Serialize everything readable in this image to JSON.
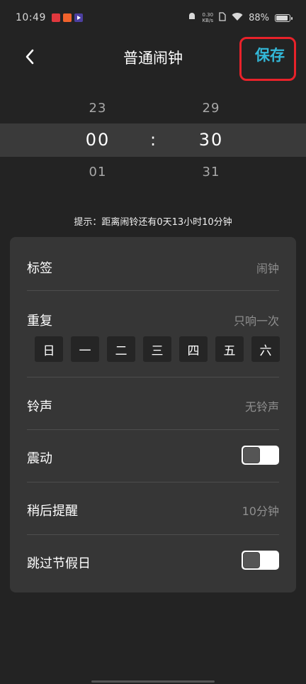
{
  "status_bar": {
    "time": "10:49",
    "net_speed_value": "0.30",
    "net_speed_unit": "KB/s",
    "battery": "88%"
  },
  "header": {
    "title": "普通闹钟",
    "save_label": "保存"
  },
  "picker": {
    "hour_prev": "23",
    "hour_current": "00",
    "hour_next": "01",
    "minute_prev": "29",
    "minute_current": "30",
    "minute_next": "31",
    "separator": ":"
  },
  "hint": "提示：距离闹铃还有0天13小时10分钟",
  "settings": {
    "label": {
      "title": "标签",
      "value": "闹钟"
    },
    "repeat": {
      "title": "重复",
      "value": "只响一次",
      "days": [
        "日",
        "一",
        "二",
        "三",
        "四",
        "五",
        "六"
      ]
    },
    "ringtone": {
      "title": "铃声",
      "value": "无铃声"
    },
    "vibrate": {
      "title": "震动"
    },
    "snooze": {
      "title": "稍后提醒",
      "value": "10分钟"
    },
    "skip_holidays": {
      "title": "跳过节假日"
    }
  },
  "colors": {
    "accent": "#33b8d8",
    "highlight_border": "#e8222a",
    "background": "#232323",
    "card": "#363636"
  }
}
